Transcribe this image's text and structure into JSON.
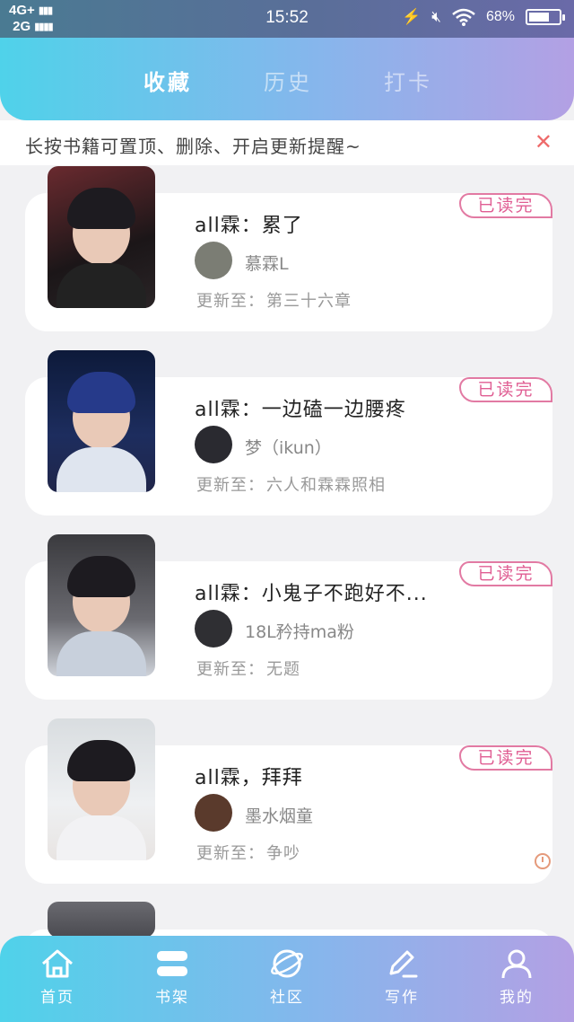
{
  "status_bar": {
    "network_top": "4G+",
    "network_bottom": "2G",
    "time": "15:52",
    "battery": "68%",
    "battery_level": 0.68
  },
  "tabs": [
    {
      "label": "收藏",
      "active": true
    },
    {
      "label": "历史",
      "active": false
    },
    {
      "label": "打卡",
      "active": false
    }
  ],
  "hint": {
    "text": "长按书籍可置顶、删除、开启更新提醒~",
    "close_icon": "close-icon"
  },
  "update_label": "更新至：",
  "books": [
    {
      "title": "all霖：累了",
      "author": "慕霖L",
      "update": "第三十六章",
      "badge": "已读完",
      "has_alarm": false
    },
    {
      "title": "all霖：一边磕一边腰疼",
      "author": "梦（ikun）",
      "update": "六人和霖霖照相",
      "badge": "已读完",
      "has_alarm": false
    },
    {
      "title": "all霖：小鬼子不跑好不...",
      "author": "18L矜持ma粉",
      "update": "无题",
      "badge": "已读完",
      "has_alarm": false
    },
    {
      "title": "all霖，拜拜",
      "author": "墨水烟童",
      "update": "争吵",
      "badge": "已读完",
      "has_alarm": true
    }
  ],
  "bottom_nav": [
    {
      "label": "首页",
      "icon": "home-icon"
    },
    {
      "label": "书架",
      "icon": "bookshelf-icon"
    },
    {
      "label": "社区",
      "icon": "planet-icon"
    },
    {
      "label": "写作",
      "icon": "pen-icon"
    },
    {
      "label": "我的",
      "icon": "user-icon"
    }
  ]
}
